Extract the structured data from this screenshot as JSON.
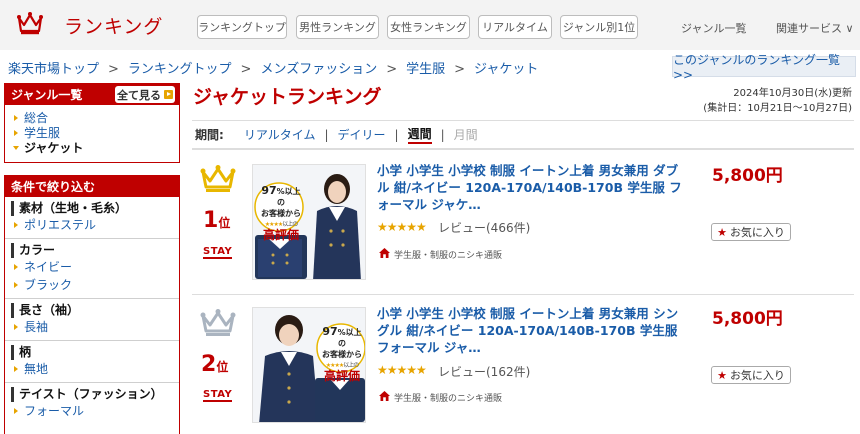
{
  "header": {
    "site_title": "ランキング",
    "nav": [
      "ランキングトップ",
      "男性ランキング",
      "女性ランキング",
      "リアルタイム",
      "ジャンル別1位"
    ],
    "genre_list": "ジャンル一覧",
    "related": "関連サービス ∨"
  },
  "breadcrumb": {
    "items": [
      "楽天市場トップ",
      "ランキングトップ",
      "メンズファッション",
      "学生服",
      "ジャケット"
    ],
    "sep": ">"
  },
  "genre_ranking_link": "このジャンルのランキング一覧 >>",
  "sidebar": {
    "genre_head": "ジャンル一覧",
    "show_all": "全て見る",
    "genres": [
      "総合",
      "学生服",
      "ジャケット"
    ],
    "filter_head": "条件で絞り込む",
    "filters": [
      {
        "title": "素材（生地・毛糸）",
        "items": [
          "ポリエステル"
        ]
      },
      {
        "title": "カラー",
        "items": [
          "ネイビー",
          "ブラック"
        ]
      },
      {
        "title": "長さ（袖）",
        "items": [
          "長袖"
        ]
      },
      {
        "title": "柄",
        "items": [
          "無地"
        ]
      },
      {
        "title": "テイスト（ファッション）",
        "items": [
          "フォーマル"
        ]
      }
    ]
  },
  "main": {
    "title": "ジャケットランキング",
    "updated": "2024年10月30日(水)更新",
    "period_range": "(集計日：10月21日～10月27日)",
    "period_label": "期間:",
    "periods": [
      "リアルタイム",
      "デイリー",
      "週間",
      "月間"
    ],
    "sep": "|"
  },
  "items": [
    {
      "rank": "1",
      "rank_unit": "位",
      "status": "STAY",
      "title": "小学 小学生 小学校 制服 イートン上着 男女兼用 ダブル 紺/ネイビー 120A-170A/140B-170B 学生服 フォーマル ジャケ…",
      "price": "5,800円",
      "stars": "★★★★★",
      "rating": 4.5,
      "reviews": "レビュー(466件)",
      "shop": "学生服・制服のニシキ通販",
      "fav": "お気に入り",
      "badge_pct": "97",
      "badge_pct_unit": "%以上の",
      "badge_line": "お客様から",
      "badge_stars": "★★★★",
      "badge_small": "以上の",
      "badge_main": "高評価",
      "medal_color": "#e8b700"
    },
    {
      "rank": "2",
      "rank_unit": "位",
      "status": "STAY",
      "title": "小学 小学生 小学校 制服 イートン上着 男女兼用 シングル 紺/ネイビー 120A-170A/140B-170B 学生服 フォーマル ジャ…",
      "price": "5,800円",
      "stars": "★★★★★",
      "rating": 4.5,
      "reviews": "レビュー(162件)",
      "shop": "学生服・制服のニシキ通販",
      "fav": "お気に入り",
      "badge_pct": "97",
      "badge_pct_unit": "%以上の",
      "badge_line": "お客様から",
      "badge_stars": "★★★★",
      "badge_small": "以上の",
      "badge_main": "高評価",
      "medal_color": "#aab4c0"
    }
  ],
  "colors": {
    "brand_red": "#bf0000",
    "link_blue": "#1a5ca8",
    "star_gold": "#e7a400"
  }
}
